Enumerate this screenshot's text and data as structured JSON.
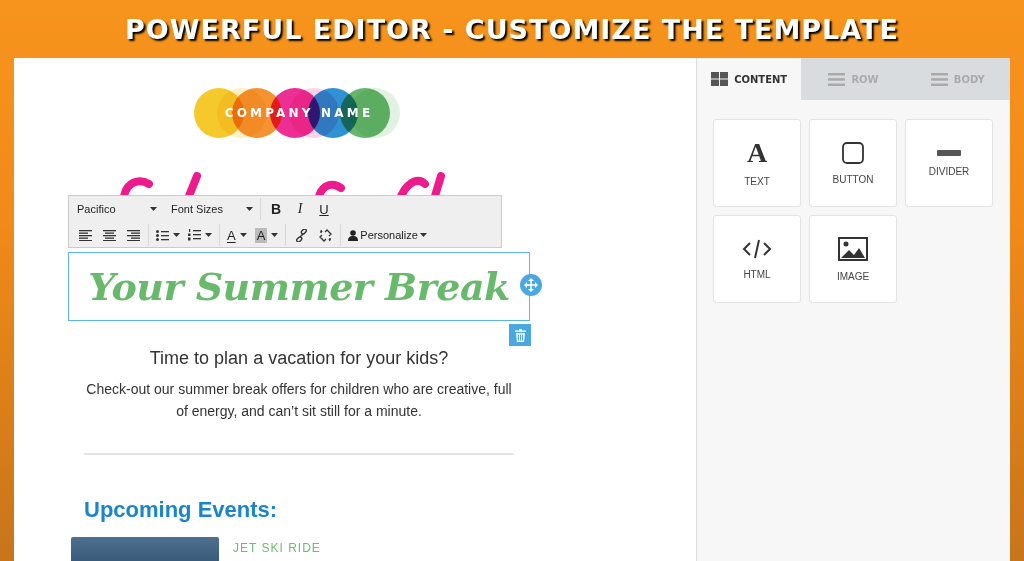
{
  "banner": {
    "title": "POWERFUL EDITOR - CUSTOMIZE THE TEMPLATE"
  },
  "email": {
    "logo": {
      "text": "COMPANY NAME"
    },
    "toolbar": {
      "font": "Pacifico",
      "font_size": "Font Sizes",
      "bold": "B",
      "italic": "I",
      "underline": "U",
      "text_color": "A",
      "highlight_color": "A",
      "personalize": "Personalize"
    },
    "headline": {
      "text": "Your Summer Break",
      "selected": true
    },
    "subtitle": "Time to plan a vacation for your kids?",
    "body": "Check-out our summer break offers for children who are creative, full of energy, and can’t sit still for a minute.",
    "section_title": "Upcoming Events:",
    "events": [
      {
        "title": "JET SKI RIDE"
      }
    ]
  },
  "panel": {
    "tabs": [
      {
        "label": "CONTENT",
        "selected": true,
        "kind": "grid"
      },
      {
        "label": "ROW",
        "selected": false,
        "kind": "lines"
      },
      {
        "label": "BODY",
        "selected": false,
        "kind": "lines"
      }
    ],
    "blocks": [
      {
        "label": "TEXT",
        "kind": "text",
        "glyph": "A"
      },
      {
        "label": "BUTTON",
        "kind": "button"
      },
      {
        "label": "DIVIDER",
        "kind": "divider"
      },
      {
        "label": "HTML",
        "kind": "html"
      },
      {
        "label": "IMAGE",
        "kind": "image"
      }
    ]
  }
}
